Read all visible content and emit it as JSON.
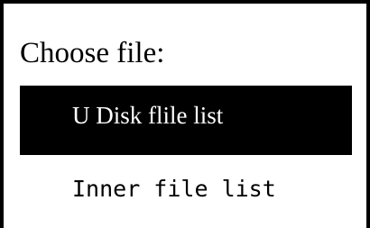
{
  "screen": {
    "title": "Choose file:"
  },
  "menu": {
    "items": [
      {
        "label": "U Disk flile list",
        "selected": true
      },
      {
        "label": "Inner file list",
        "selected": false
      }
    ]
  },
  "colors": {
    "background": "#ffffff",
    "foreground": "#000000",
    "selection_bg": "#000000",
    "selection_fg": "#ffffff"
  }
}
